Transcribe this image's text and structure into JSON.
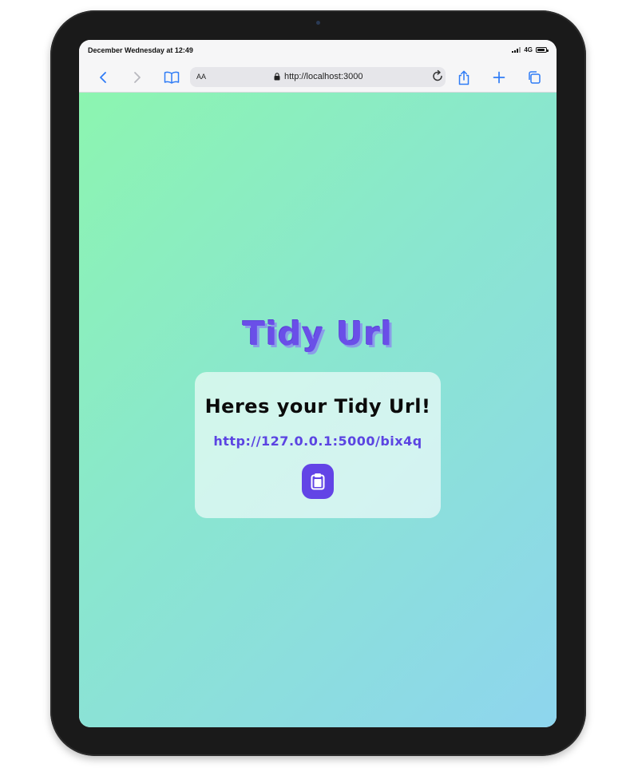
{
  "status_bar": {
    "time": "December Wednesday at 12:49",
    "network": "4G"
  },
  "browser": {
    "text_size_label": "AA",
    "address": "http://localhost:3000",
    "icons": [
      "back-icon",
      "forward-icon",
      "bookmarks-icon",
      "lock-icon",
      "reload-icon",
      "share-icon",
      "new-tab-icon",
      "tabs-icon"
    ]
  },
  "page": {
    "brand": "Tidy Url",
    "card": {
      "title": "Heres your Tidy Url!",
      "short_url": "http://127.0.0.1:5000/bix4q",
      "copy_icon": "clipboard-icon"
    }
  },
  "colors": {
    "accent": "#6244e6",
    "gradient_start": "#8cf5b0",
    "gradient_end": "#8ed5ee",
    "browser_link": "#2f7cf6"
  }
}
